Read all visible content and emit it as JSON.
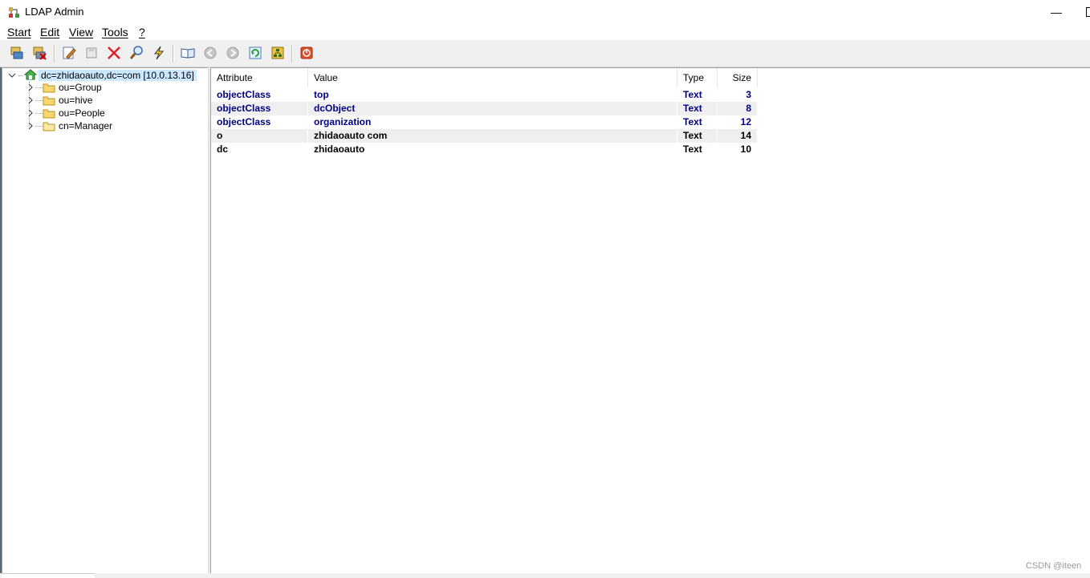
{
  "window": {
    "title": "LDAP Admin",
    "minimize_glyph": "—"
  },
  "menu": [
    {
      "label": "Start"
    },
    {
      "label": "Edit"
    },
    {
      "label": "View"
    },
    {
      "label": "Tools"
    },
    {
      "label": "?"
    }
  ],
  "toolbar": {
    "buttons": [
      {
        "name": "connect-icon"
      },
      {
        "name": "disconnect-icon"
      },
      {
        "name": "edit-entry-icon"
      },
      {
        "name": "save-icon"
      },
      {
        "name": "delete-icon"
      },
      {
        "name": "search-icon"
      },
      {
        "name": "lightning-icon"
      },
      {
        "name": "schema-book-icon"
      },
      {
        "name": "back-icon"
      },
      {
        "name": "forward-icon"
      },
      {
        "name": "refresh-icon"
      },
      {
        "name": "tree-icon"
      },
      {
        "name": "exit-icon"
      }
    ]
  },
  "tree": {
    "root": {
      "label": "dc=zhidaoauto,dc=com [10.0.13.16]",
      "icon": "server-home-icon"
    },
    "children": [
      {
        "label": "ou=Group",
        "icon": "folder-icon",
        "expandable": true
      },
      {
        "label": "ou=hive",
        "icon": "folder-icon",
        "expandable": true
      },
      {
        "label": "ou=People",
        "icon": "folder-icon",
        "expandable": true
      },
      {
        "label": "cn=Manager",
        "icon": "folder-icon",
        "expandable": true
      }
    ]
  },
  "grid": {
    "columns": [
      "Attribute",
      "Value",
      "Type",
      "Size"
    ],
    "rows": [
      {
        "attribute": "objectClass",
        "value": "top",
        "type": "Text",
        "size": "3",
        "color": "#000080"
      },
      {
        "attribute": "objectClass",
        "value": "dcObject",
        "type": "Text",
        "size": "8",
        "color": "#000080"
      },
      {
        "attribute": "objectClass",
        "value": "organization",
        "type": "Text",
        "size": "12",
        "color": "#000080"
      },
      {
        "attribute": "o",
        "value": "zhidaoauto com",
        "type": "Text",
        "size": "14",
        "color": "#000000"
      },
      {
        "attribute": "dc",
        "value": "zhidaoauto",
        "type": "Text",
        "size": "10",
        "color": "#000000"
      }
    ]
  },
  "watermark": "CSDN @iteen"
}
